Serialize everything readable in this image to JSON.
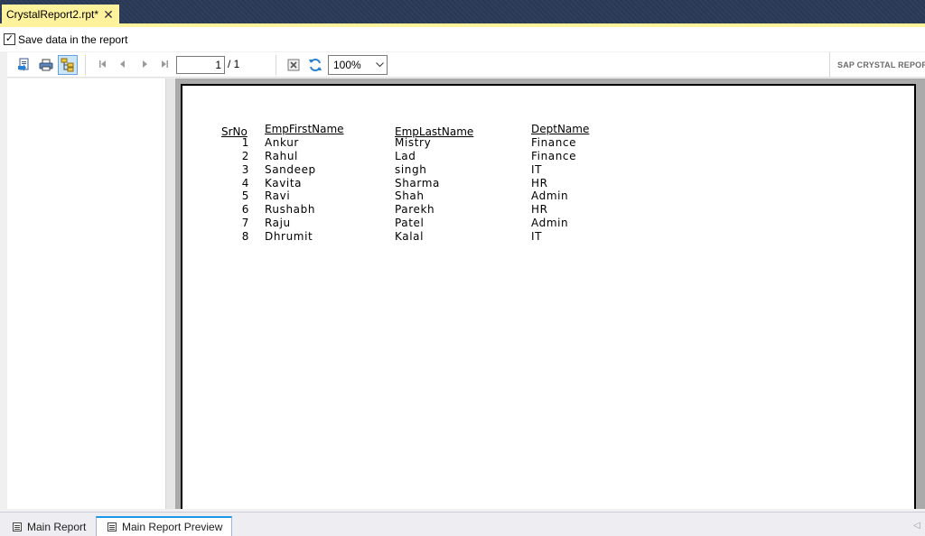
{
  "document_tab": {
    "title": "CrystalReport2.rpt*",
    "close_icon": "close-icon"
  },
  "save_data": {
    "label": "Save data in the report",
    "checked": true
  },
  "toolbar": {
    "page_current": "1",
    "page_total": "/ 1",
    "zoom": "100%",
    "brand": "SAP CRYSTAL REPORTS"
  },
  "report": {
    "headers": {
      "srno": "SrNo",
      "first": "EmpFirstName",
      "last": "EmpLastName",
      "dept": "DeptName"
    },
    "rows": [
      {
        "srno": "1",
        "first": "Ankur",
        "last": "Mistry",
        "dept": "Finance"
      },
      {
        "srno": "2",
        "first": "Rahul",
        "last": "Lad",
        "dept": "Finance"
      },
      {
        "srno": "3",
        "first": "Sandeep",
        "last": "singh",
        "dept": "IT"
      },
      {
        "srno": "4",
        "first": "Kavita",
        "last": "Sharma",
        "dept": "HR"
      },
      {
        "srno": "5",
        "first": "Ravi",
        "last": "Shah",
        "dept": "Admin"
      },
      {
        "srno": "6",
        "first": "Rushabh",
        "last": "Parekh",
        "dept": "HR"
      },
      {
        "srno": "7",
        "first": "Raju",
        "last": "Patel",
        "dept": "Admin"
      },
      {
        "srno": "8",
        "first": "Dhrumit",
        "last": "Kalal",
        "dept": "IT"
      }
    ]
  },
  "bottom_tabs": [
    {
      "label": "Main Report",
      "active": false
    },
    {
      "label": "Main Report Preview",
      "active": true
    }
  ],
  "colors": {
    "tab_accent": "#fff29d",
    "title_bar": "#293955",
    "active_tab_border": "#1c97ea"
  }
}
